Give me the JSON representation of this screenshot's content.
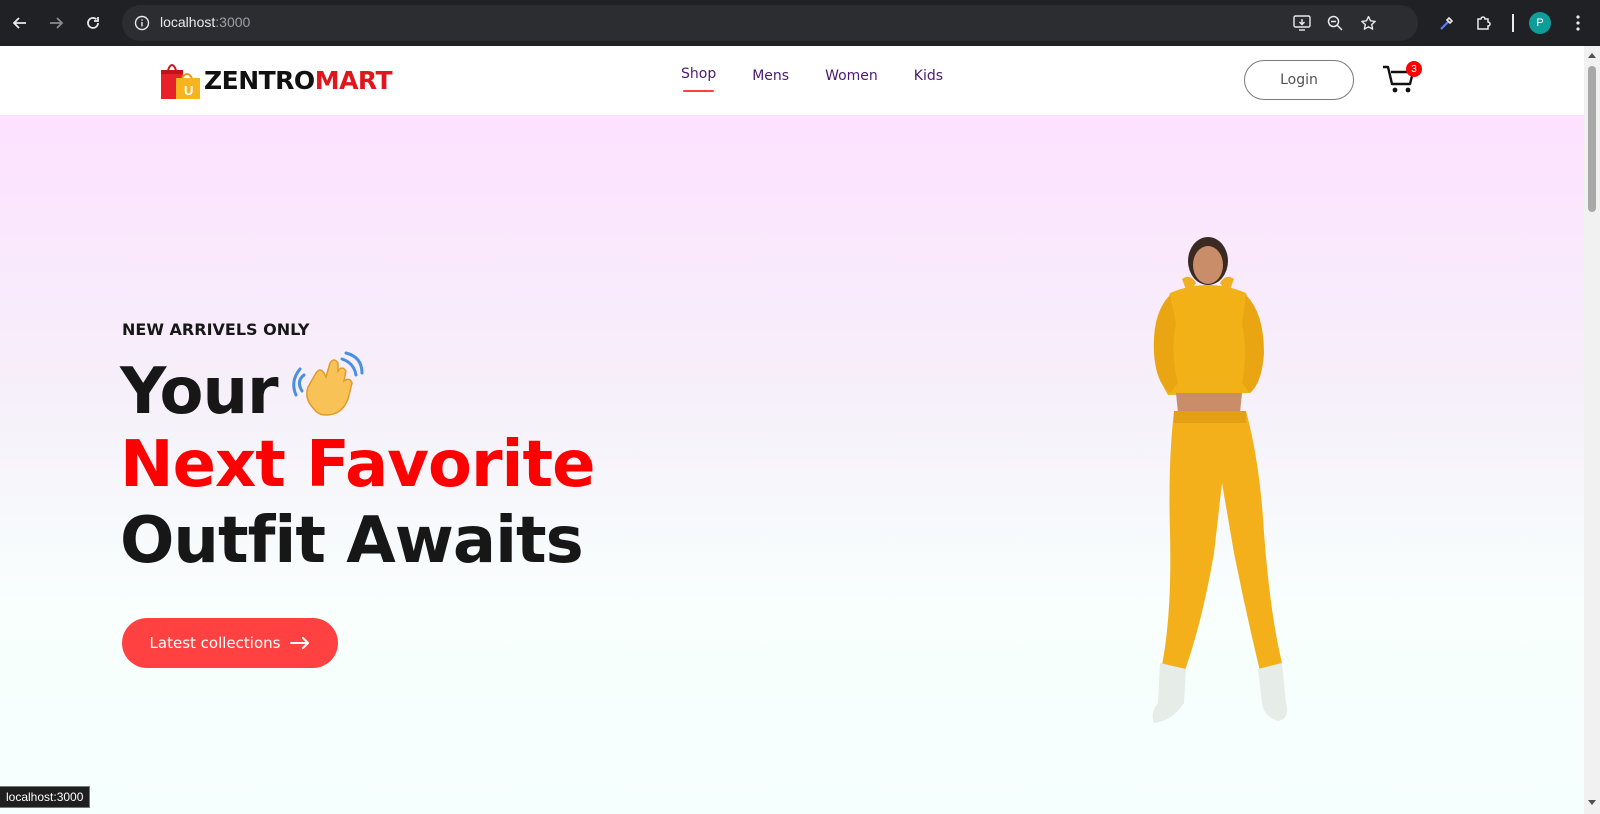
{
  "browser": {
    "url_host": "localhost",
    "url_port": ":3000",
    "profile_initial": "P",
    "status_url": "localhost:3000"
  },
  "brand": {
    "name_part1": "ZENTRO",
    "name_part2": "MART",
    "accent_color": "#e0161d"
  },
  "nav": {
    "items": [
      {
        "label": "Shop",
        "active": true
      },
      {
        "label": "Mens",
        "active": false
      },
      {
        "label": "Women",
        "active": false
      },
      {
        "label": "Kids",
        "active": false
      }
    ],
    "login_label": "Login",
    "cart_count": "3"
  },
  "hero": {
    "tagline": "NEW ARRIVELS ONLY",
    "line1": "Your",
    "line2": "Next Favorite",
    "line3": "Outfit Awaits",
    "cta_label": "Latest collections",
    "cta_color": "#ff4141"
  }
}
